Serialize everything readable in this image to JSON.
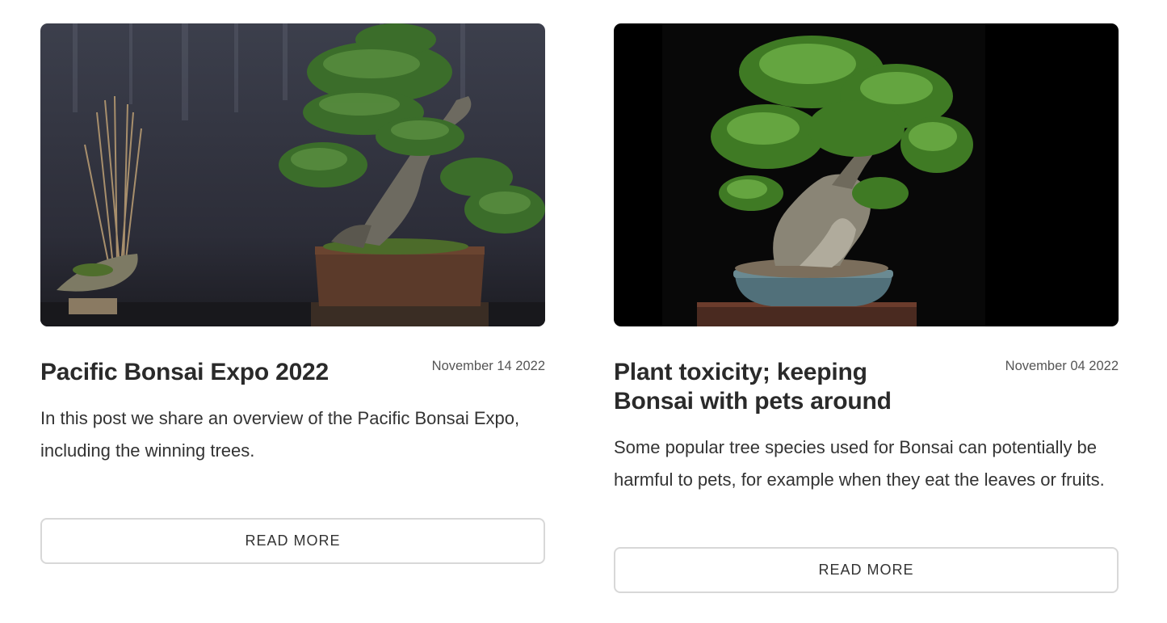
{
  "posts": [
    {
      "image_alt": "Japanese black pine bonsai in brown rectangular pot with grass accent",
      "title": "Pacific Bonsai Expo 2022",
      "date": "November 14 2022",
      "excerpt": "In this post we share an overview of the Pacific Bonsai Expo, including the winning trees.",
      "button_label": "READ MORE"
    },
    {
      "image_alt": "Deciduous bonsai tree on black background in blue oval pot",
      "title": "Plant toxicity; keeping Bonsai with pets around",
      "date": "November 04 2022",
      "excerpt": "Some popular tree species used for Bonsai can potentially be harmful to pets, for example when they eat the leaves or fruits.",
      "button_label": "READ MORE"
    }
  ]
}
